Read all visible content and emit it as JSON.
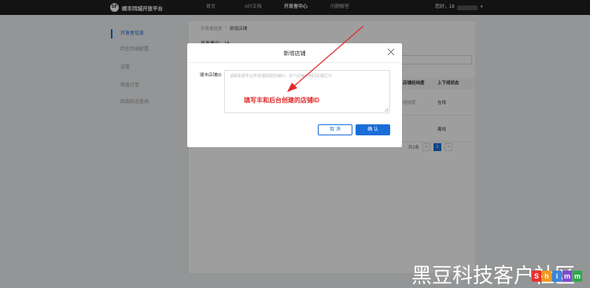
{
  "topbar": {
    "brand": "顺丰同城开放平台",
    "brand_mark": "SF",
    "nav": [
      "首页",
      "API文档",
      "开发者中心",
      "问题解答"
    ],
    "user_prefix": "您好，18"
  },
  "sidebar": {
    "items": [
      "开发者信息",
      "回主回调配置",
      "设置",
      "筛选订单",
      "回调状态查询"
    ]
  },
  "main": {
    "breadcrumb": [
      "开发者信息",
      "新增店铺"
    ],
    "dev_id_label": "开发者ID：16",
    "table_headers": [
      "店铺经纬度",
      "上下线状态"
    ],
    "rows": [
      {
        "c1": "经纬度",
        "c2": "在线"
      },
      {
        "c1": "",
        "c2": "离线"
      }
    ],
    "pager": {
      "total": "共2条",
      "prev": "<",
      "page": "1",
      "next": ">"
    }
  },
  "modal": {
    "title": "新增店铺",
    "label": "顺丰店铺ID",
    "placeholder": "请联系顺丰业务经理获取店铺ID，多个店铺ID用回车键区分",
    "annotation": "填写丰和后台创建的店铺ID",
    "cancel": "取 消",
    "ok": "确 认"
  },
  "watermark": {
    "text": "黑豆科技客户社区",
    "logo": [
      "S",
      "h",
      "i",
      "m",
      "m"
    ]
  },
  "colors": {
    "accent": "#1a6ed8",
    "annotation": "#e02b2b",
    "topbar": "#1f1f1f"
  }
}
